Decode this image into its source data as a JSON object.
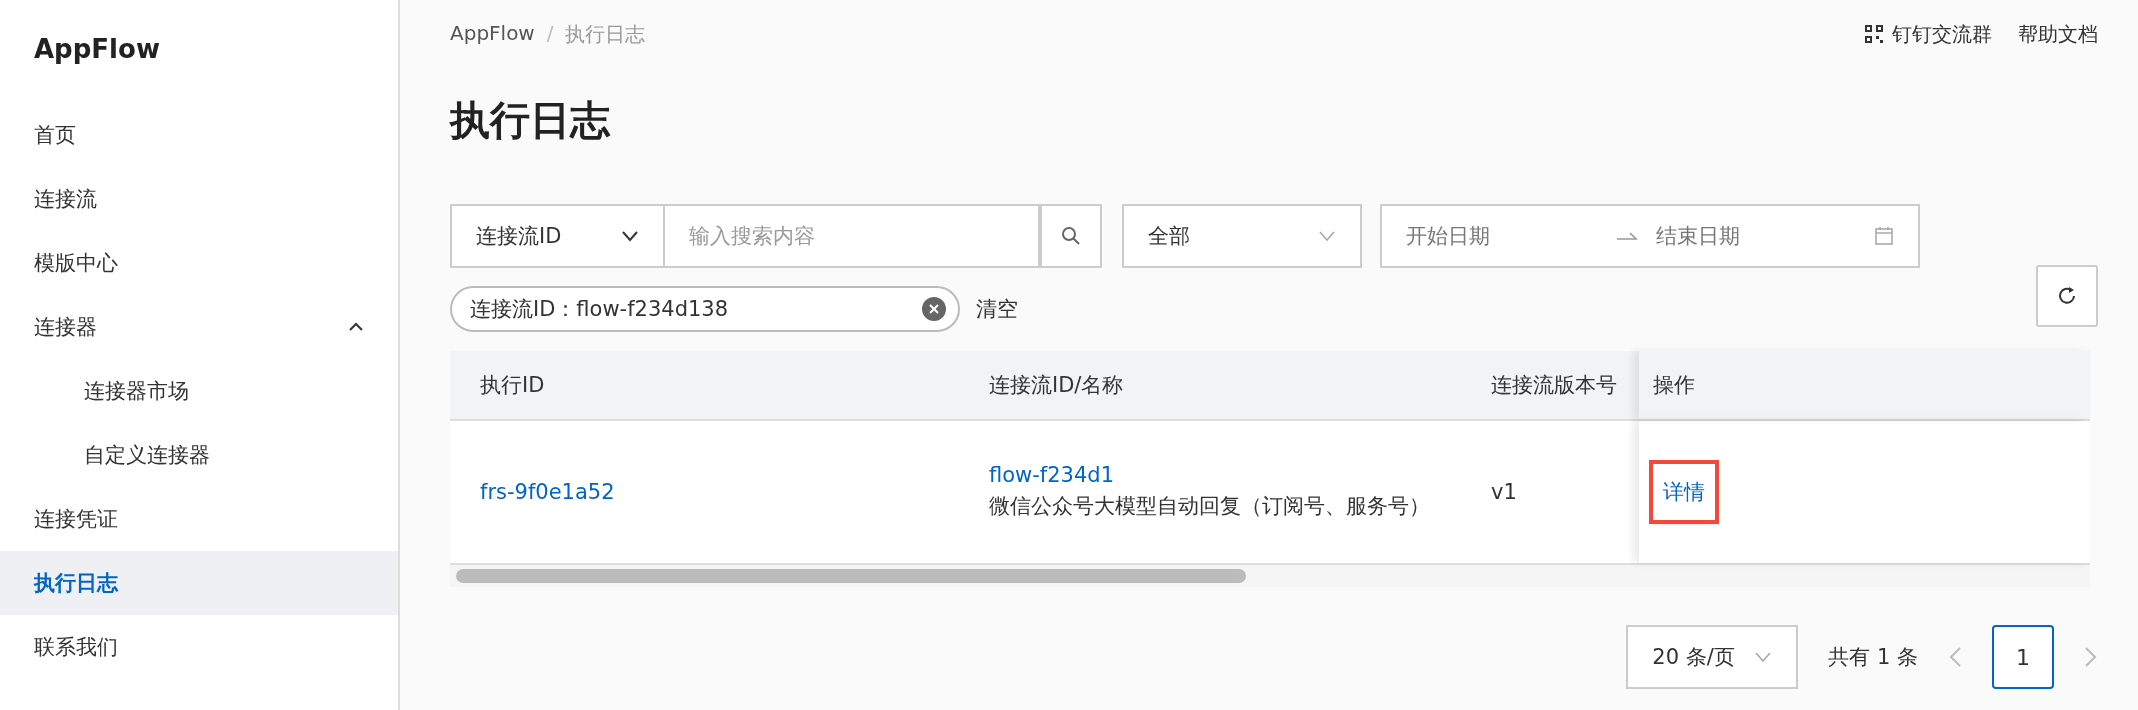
{
  "sidebar": {
    "logo": "AppFlow",
    "items": [
      {
        "label": "首页",
        "selected": false
      },
      {
        "label": "连接流",
        "selected": false
      },
      {
        "label": "模版中心",
        "selected": false
      },
      {
        "label": "连接器",
        "selected": false,
        "expanded": true,
        "children": [
          {
            "label": "连接器市场",
            "selected": false
          },
          {
            "label": "自定义连接器",
            "selected": false
          }
        ]
      },
      {
        "label": "连接凭证",
        "selected": false
      },
      {
        "label": "执行日志",
        "selected": true
      },
      {
        "label": "联系我们",
        "selected": false
      }
    ]
  },
  "header": {
    "breadcrumb": [
      "AppFlow",
      "执行日志"
    ],
    "breadcrumb_separator": "/",
    "links": [
      {
        "label": "钉钉交流群",
        "kind": "qr"
      },
      {
        "label": "帮助文档",
        "kind": "text"
      }
    ]
  },
  "title": "执行日志",
  "filters": {
    "field_select": "连接流ID",
    "search": {
      "placeholder": "输入搜索内容"
    },
    "status_select": "全部",
    "date_range": {
      "start_placeholder": "开始日期",
      "end_placeholder": "结束日期"
    }
  },
  "active_filters": [
    {
      "label": "连接流ID：flow-f234d138"
    }
  ],
  "clear_label": "清空",
  "table": {
    "columns": [
      "执行ID",
      "连接流ID/名称",
      "连接流版本号",
      "操作"
    ],
    "rows": [
      {
        "execution_id": "frs-9f0e1a52",
        "flow_id": "flow-f234d1",
        "flow_name": "微信公众号大模型自动回复（订阅号、服务号）",
        "version": "v1",
        "action": "详情",
        "highlighted": true
      }
    ]
  },
  "pagination": {
    "page_size": "20 条/页",
    "total": "共有 1 条",
    "pages": [
      {
        "label": "1",
        "selected": true
      }
    ]
  }
}
